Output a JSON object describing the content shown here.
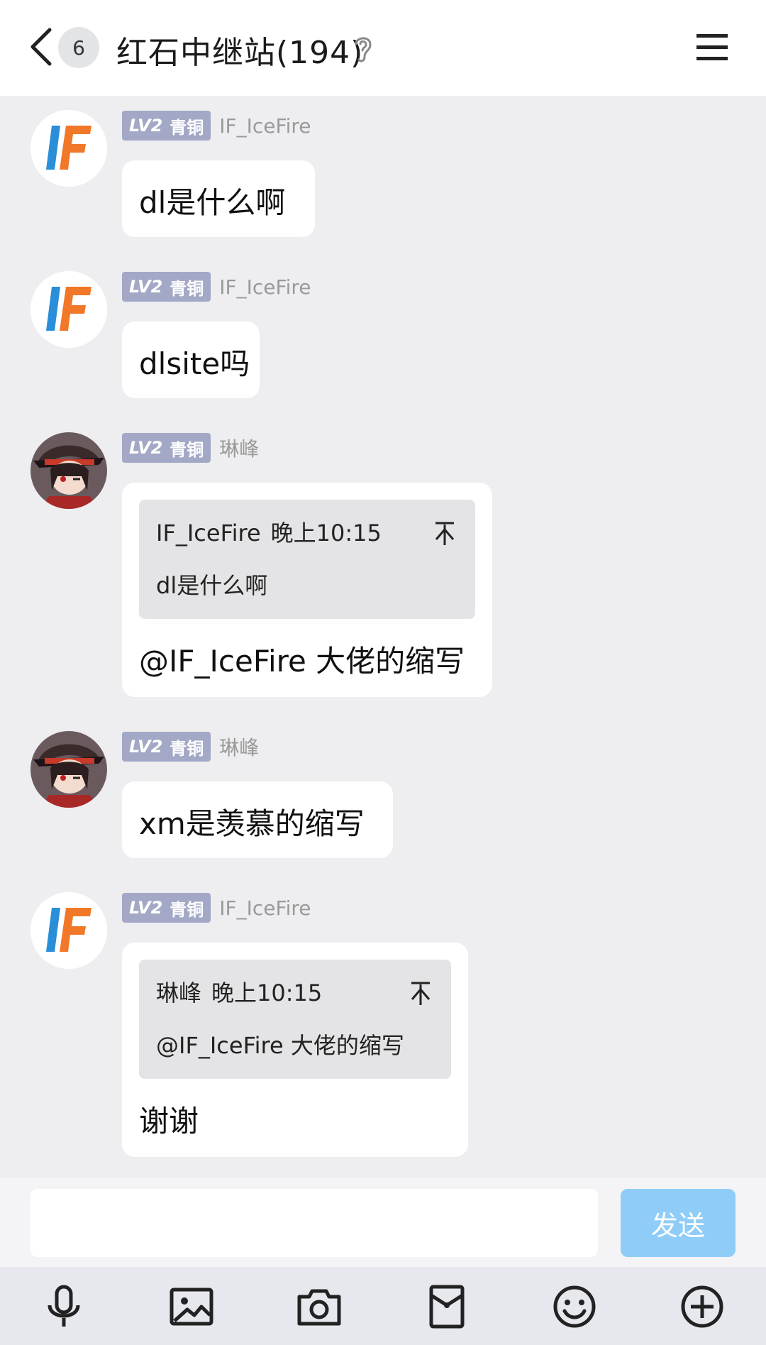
{
  "header": {
    "unread_count": "6",
    "title": "红石中继站(194)"
  },
  "level_badge": {
    "lv": "LV2",
    "rank": "青铜"
  },
  "messages": [
    {
      "sender": "IF_IceFire",
      "text": "dl是什么啊"
    },
    {
      "sender": "IF_IceFire",
      "text": "dlsite吗"
    },
    {
      "sender": "琳峰",
      "quote_sender": "IF_IceFire",
      "quote_time": "晚上10:15",
      "quote_text": "dl是什么啊",
      "text": "@IF_IceFire 大佬的缩写"
    },
    {
      "sender": "琳峰",
      "text": "xm是羡慕的缩写"
    },
    {
      "sender": "IF_IceFire",
      "quote_sender": "琳峰",
      "quote_time": "晚上10:15",
      "quote_text": "@IF_IceFire 大佬的缩写",
      "text": "谢谢"
    }
  ],
  "input": {
    "placeholder": "",
    "send_label": "发送"
  },
  "toolbar": [
    "microphone-icon",
    "image-icon",
    "camera-icon",
    "red-envelope-icon",
    "emoji-icon",
    "plus-icon"
  ],
  "colors": {
    "send_button": "#8fcdf8",
    "level_badge": "#a3a8c6",
    "background": "#eeedf0"
  }
}
